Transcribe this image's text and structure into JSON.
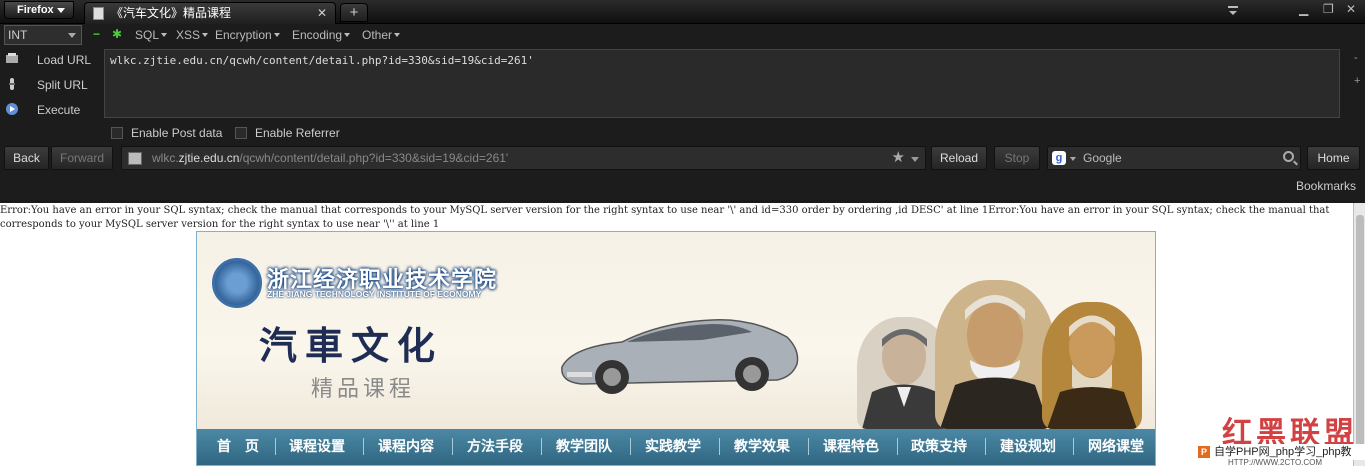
{
  "browser": {
    "app_button": "Firefox",
    "tab_title": "《汽车文化》精品课程",
    "new_tab": "+"
  },
  "hackbar": {
    "type_select": "INT",
    "menus": [
      "SQL",
      "XSS",
      "Encryption",
      "Encoding",
      "Other"
    ],
    "load_url": "Load URL",
    "split_url": "Split URL",
    "execute": "Execute",
    "url_value": "wlkc.zjtie.edu.cn/qcwh/content/detail.php?id=330&sid=19&cid=261'",
    "enable_post": "Enable Post data",
    "enable_referrer": "Enable Referrer"
  },
  "nav": {
    "back": "Back",
    "forward": "Forward",
    "address_prefix": "wlkc.",
    "address_domain": "zjtie.edu.cn",
    "address_path": "/qcwh/content/detail.php?id=330&sid=19&cid=261'",
    "reload": "Reload",
    "stop": "Stop",
    "search_engine": "Google",
    "home": "Home"
  },
  "bookmarks": {
    "label": "Bookmarks"
  },
  "page": {
    "error_text": "Error:You have an error in your SQL syntax; check the manual that corresponds to your MySQL server version for the right syntax to use near '\\' and id=330 order by ordering ,id DESC' at line 1Error:You have an error in your SQL syntax; check the manual that corresponds to your MySQL server version for the right syntax to use near '\\'' at line 1",
    "logo_cn": "浙江经济职业技术学院",
    "logo_en": "ZHE JIANG TECHNOLOGY INSTITUTE OF ECONOMY",
    "title": "汽車文化",
    "subtitle": "精品课程",
    "menu": [
      "首　页",
      "课程设置",
      "课程内容",
      "方法手段",
      "教学团队",
      "实践教学",
      "教学效果",
      "课程特色",
      "政策支持",
      "建设规划",
      "网络课堂"
    ]
  },
  "watermark": {
    "logo_text": "红黑联盟",
    "bar_text": "自学PHP网_php学习_php教",
    "url_text": "HTTP://WWW.2CTO.COM"
  }
}
